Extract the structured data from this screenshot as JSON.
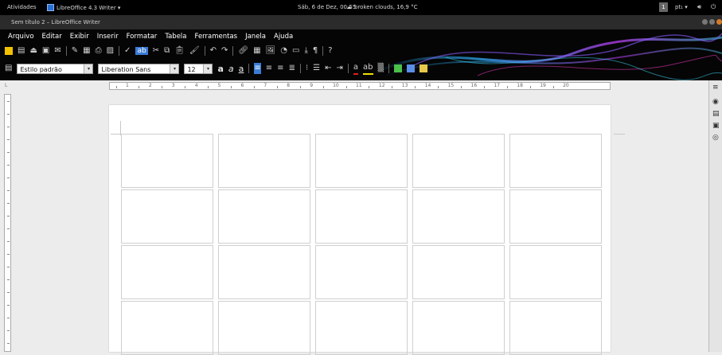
{
  "topbar": {
    "activities": "Atividades",
    "app_menu": "LibreOffice 4.3 Writer ▾",
    "clock": "Sáb, 6 de Dez, 00:55",
    "weather_icon": "cloud-icon",
    "weather": "broken clouds, 16,9 °C",
    "workspace": "1",
    "language": "pt₁ ▾",
    "volume_icon": "speaker-icon",
    "power_icon": "power-icon"
  },
  "window": {
    "title": "Sem título 2 – LibreOffice Writer"
  },
  "menu": {
    "items": [
      "Arquivo",
      "Editar",
      "Exibir",
      "Inserir",
      "Formatar",
      "Tabela",
      "Ferramentas",
      "Janela",
      "Ajuda"
    ]
  },
  "format_toolbar": {
    "paragraph_style": "Estilo padrão",
    "font_name": "Liberation Sans",
    "font_size": "12",
    "bold": "a",
    "italic": "a",
    "underline": "a"
  },
  "ruler": {
    "numbers": [
      "1",
      "2",
      "3",
      "4",
      "5",
      "6",
      "7",
      "8",
      "9",
      "10",
      "11",
      "12",
      "13",
      "14",
      "15",
      "16",
      "17",
      "18",
      "19",
      "20"
    ],
    "corner": "L"
  },
  "document": {
    "rows": 4,
    "columns": 5
  },
  "colors": {
    "topbar": "#000000",
    "titlebar": "#2b2b2b",
    "toolbar_bg": "#050505",
    "page": "#ffffff",
    "workspace": "#ececec",
    "swirl_primary": "#2fb5ff",
    "swirl_secondary": "#c040ff"
  }
}
